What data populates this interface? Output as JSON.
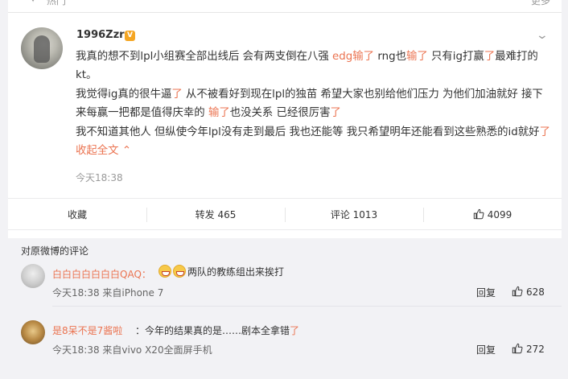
{
  "hot_bar": {
    "label": "热门",
    "more": "更多"
  },
  "post": {
    "username": "1996Zzr",
    "vip_badge": "V",
    "paragraphs": [
      [
        {
          "t": "我真的想不到lpl小组赛全部出线后 会有两支倒在八强 ",
          "red": false
        },
        {
          "t": "edg输了",
          "red": true
        },
        {
          "t": " rng也",
          "red": false
        },
        {
          "t": "输了",
          "red": true
        },
        {
          "t": " 只有ig打赢",
          "red": false
        },
        {
          "t": "了",
          "red": true
        },
        {
          "t": "最难打的kt。",
          "red": false
        }
      ],
      [
        {
          "t": "我觉得ig真的很牛逼",
          "red": false
        },
        {
          "t": "了",
          "red": true
        },
        {
          "t": " 从不被看好到现在lpl的独苗 希望大家也别给他们压力 为他们加油就好 接下来每赢一把都是值得庆幸的 ",
          "red": false
        },
        {
          "t": "输了",
          "red": true
        },
        {
          "t": "也没关系 已经很厉害",
          "red": false
        },
        {
          "t": "了",
          "red": true
        }
      ],
      [
        {
          "t": "我不知道其他人 但纵使今年lpl没有走到最后 我也还能等 我只希望明年还能看到这些熟悉的id就好",
          "red": false
        },
        {
          "t": "了",
          "red": true
        },
        {
          "t": " 收起全文",
          "red": true
        }
      ]
    ],
    "collapse_icon": "chevron-up-icon",
    "time": "今天18:38"
  },
  "actions": {
    "favorite": "收藏",
    "repost": "转发 465",
    "comment": "评论 1013",
    "like": "4099"
  },
  "comments": {
    "title": "对原微博的评论",
    "items": [
      {
        "name": "白白白白白白白QAQ：",
        "text": "两队的教练组出来挨打",
        "emojis": 2,
        "meta": "今天18:38 来自iPhone 7",
        "reply": "回复",
        "likes": "628"
      },
      {
        "name": "是8呆不是7酱啦",
        "text_before": "：今年的结果真的是……剧本全拿错",
        "text_red": "了",
        "meta": "今天18:38 来自vivo X20全面屏手机",
        "reply": "回复",
        "likes": "272"
      }
    ]
  },
  "colors": {
    "accent": "#eb7350",
    "bg": "#f2f2f5",
    "card": "#ffffff",
    "vip": "#f5a623"
  }
}
